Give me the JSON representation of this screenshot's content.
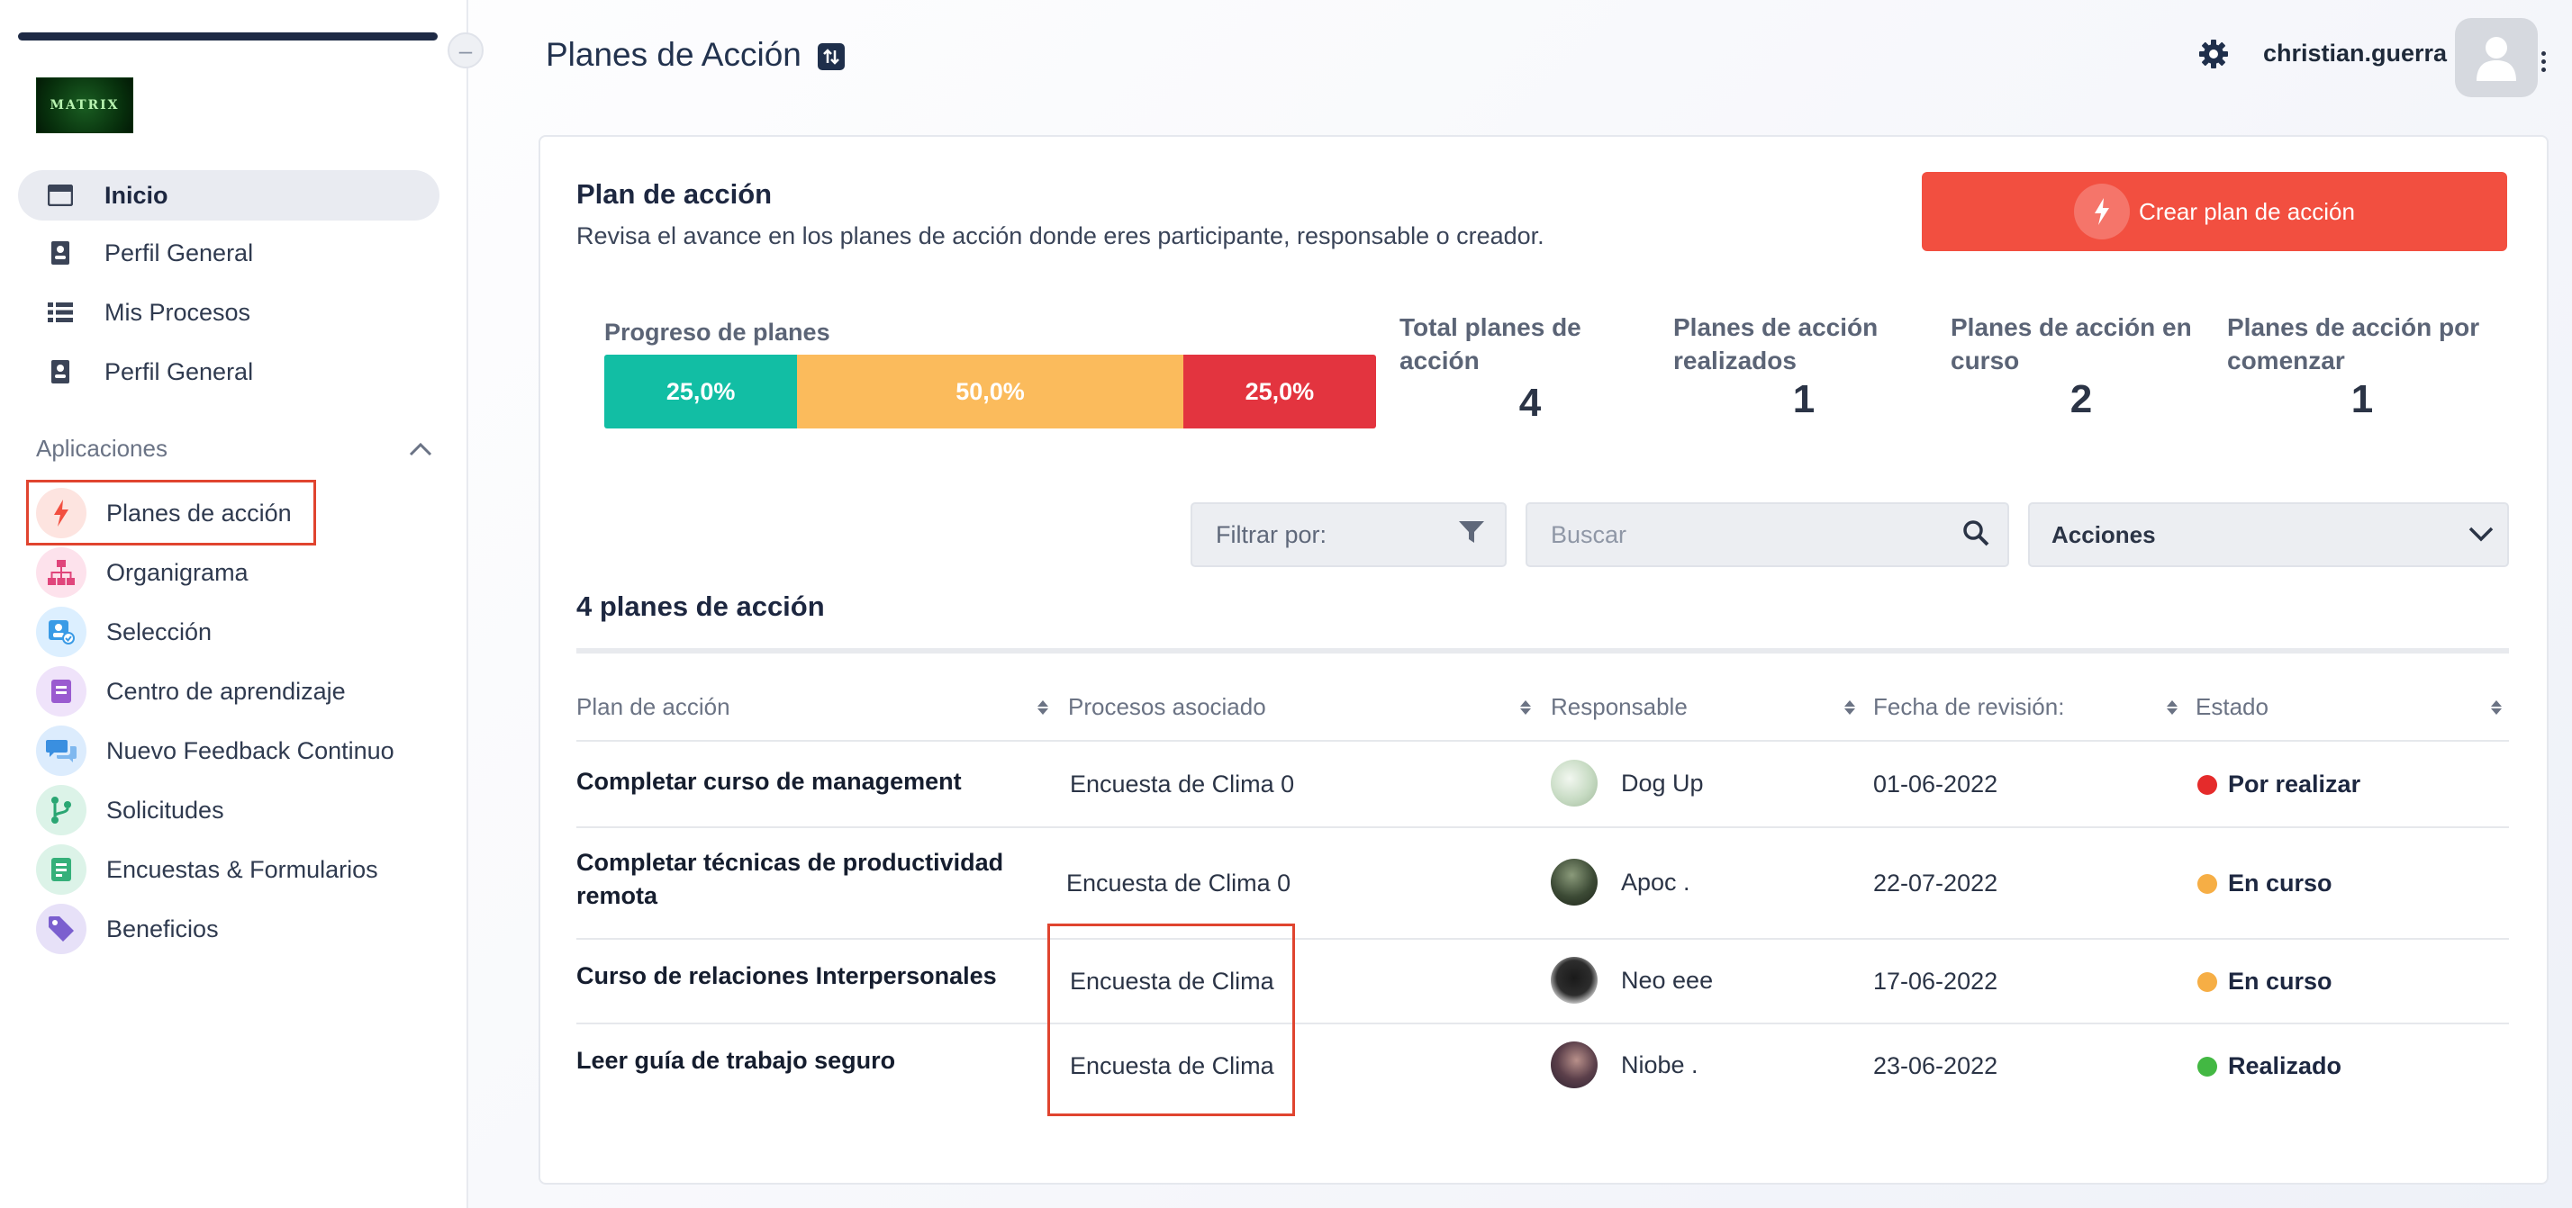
{
  "header": {
    "page_title": "Planes de Acción",
    "username": "christian.guerra"
  },
  "logo_text": "MATRIX",
  "sidebar": {
    "collapse_symbol": "–",
    "items": [
      {
        "label": "Inicio",
        "icon": "window-icon"
      },
      {
        "label": "Perfil General",
        "icon": "id-card-icon"
      },
      {
        "label": "Mis Procesos",
        "icon": "list-icon"
      },
      {
        "label": "Perfil General",
        "icon": "id-card-icon"
      }
    ],
    "apps_header": "Aplicaciones",
    "apps": [
      {
        "label": "Planes de acción",
        "icon": "bolt-icon",
        "color": "#f24f40"
      },
      {
        "label": "Organigrama",
        "icon": "org-chart-icon",
        "color": "#e0457b"
      },
      {
        "label": "Selección",
        "icon": "user-check-icon",
        "color": "#3a9be6"
      },
      {
        "label": "Centro de aprendizaje",
        "icon": "book-icon",
        "color": "#9a5bd0"
      },
      {
        "label": "Nuevo Feedback Continuo",
        "icon": "chat-icon",
        "color": "#3a8fe0"
      },
      {
        "label": "Solicitudes",
        "icon": "branch-icon",
        "color": "#2aa673"
      },
      {
        "label": "Encuestas & Formularios",
        "icon": "form-icon",
        "color": "#35b07a"
      },
      {
        "label": "Beneficios",
        "icon": "tag-icon",
        "color": "#7b5fcf"
      }
    ]
  },
  "card": {
    "title": "Plan de acción",
    "subtitle": "Revisa el avance en los planes de acción donde eres participante, responsable o creador.",
    "create_button": "Crear plan de acción"
  },
  "progress": {
    "label": "Progreso de planes",
    "segments": [
      {
        "text": "25,0%",
        "fraction": 0.25,
        "color": "#12bea4"
      },
      {
        "text": "50,0%",
        "fraction": 0.5,
        "color": "#fbbb5c"
      },
      {
        "text": "25,0%",
        "fraction": 0.25,
        "color": "#e3343f"
      }
    ]
  },
  "stats": [
    {
      "label": "Total planes de acción",
      "value": "4"
    },
    {
      "label": "Planes de acción realizados",
      "value": "1"
    },
    {
      "label": "Planes de acción en curso",
      "value": "2"
    },
    {
      "label": "Planes de acción por comenzar",
      "value": "1"
    }
  ],
  "filters": {
    "filter_label": "Filtrar por:",
    "search_placeholder": "Buscar",
    "search_value": "",
    "actions_label": "Acciones"
  },
  "table": {
    "count_title": "4 planes de acción",
    "columns": [
      "Plan de acción",
      "Procesos asociado",
      "Responsable",
      "Fecha de revisión:",
      "Estado"
    ],
    "rows": [
      {
        "plan": "Completar curso de management",
        "proceso": "Encuesta de Clima 0",
        "responsable": "Dog Up",
        "fecha": "01-06-2022",
        "estado": "Por realizar",
        "estado_color": "#e52b2b"
      },
      {
        "plan": "Completar técnicas de productividad remota",
        "proceso": "Encuesta de Clima 0",
        "responsable": "Apoc .",
        "fecha": "22-07-2022",
        "estado": "En curso",
        "estado_color": "#f6ae45"
      },
      {
        "plan": "Curso de relaciones Interpersonales",
        "proceso": "Encuesta de Clima",
        "responsable": "Neo eee",
        "fecha": "17-06-2022",
        "estado": "En curso",
        "estado_color": "#f6ae45"
      },
      {
        "plan": "Leer guía de trabajo seguro",
        "proceso": "Encuesta de Clima",
        "responsable": "Niobe .",
        "fecha": "23-06-2022",
        "estado": "Realizado",
        "estado_color": "#43b843"
      }
    ]
  },
  "colors": {
    "accent_red": "#f24f40",
    "highlight_border": "#e0442f",
    "nav_dark": "#1e2a45"
  }
}
